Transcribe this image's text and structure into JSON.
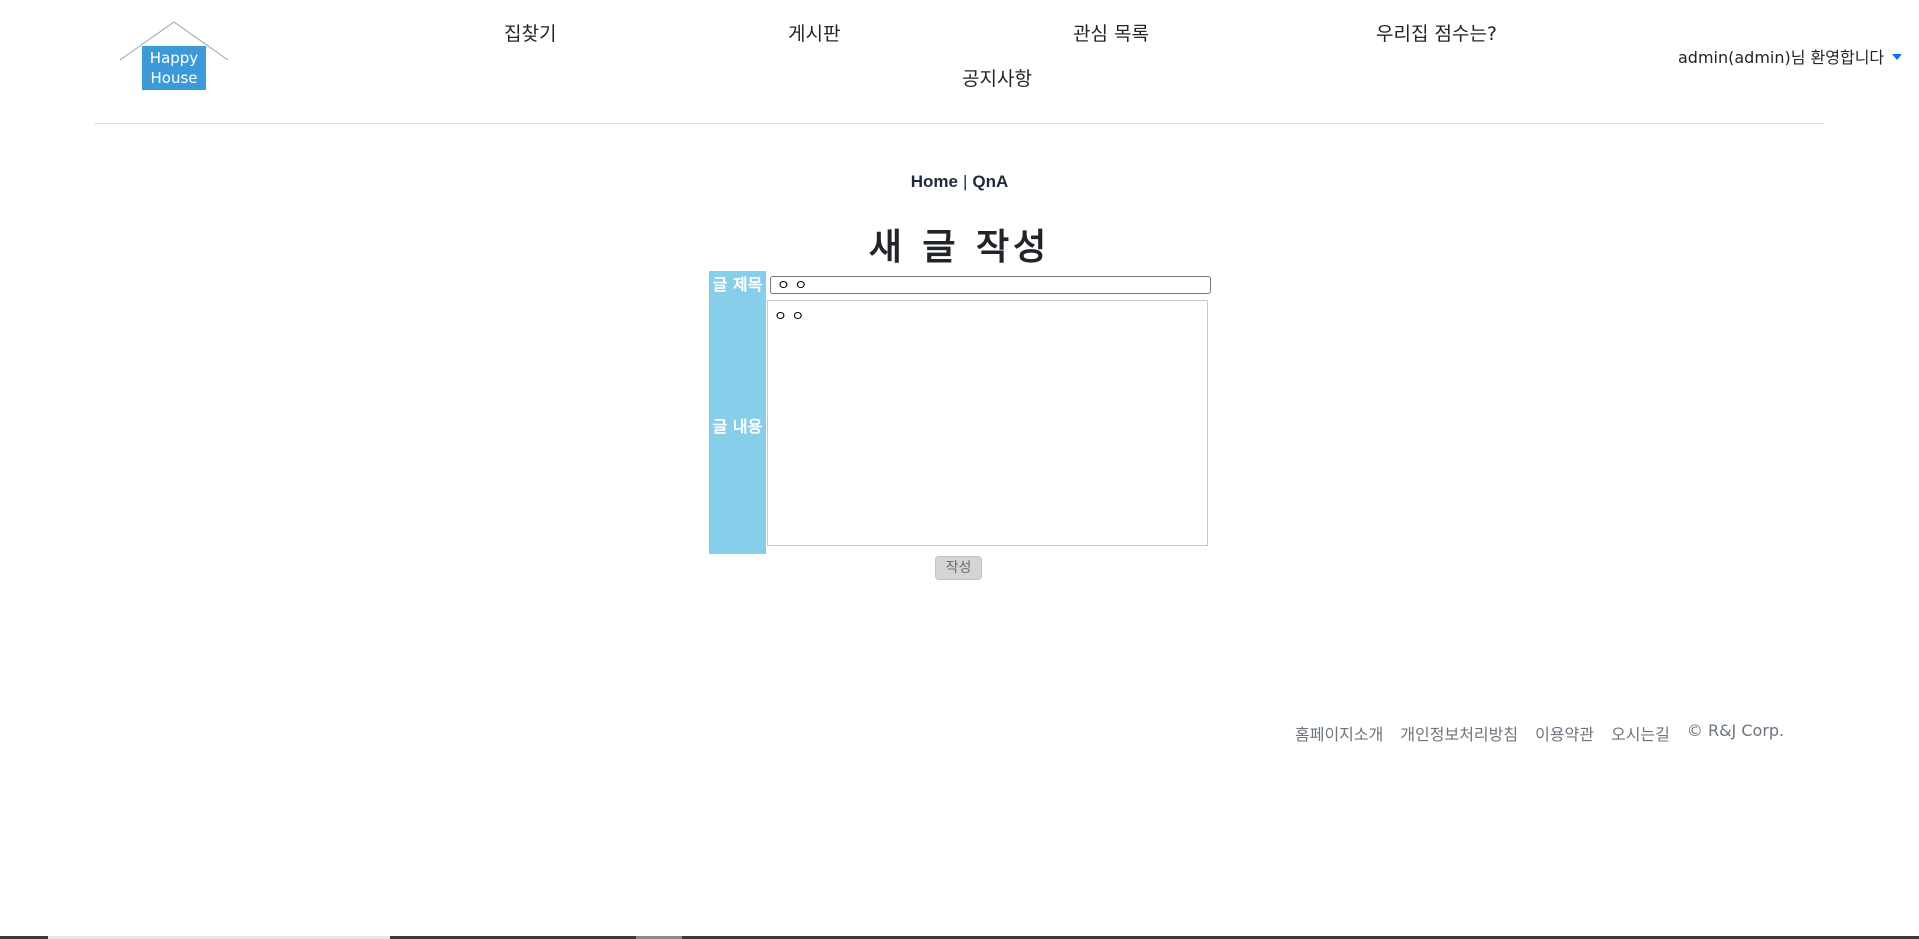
{
  "logo": {
    "line1": "Happy",
    "line2": "House",
    "color": "#3c9ad9"
  },
  "nav": {
    "items": [
      {
        "label": "집찾기"
      },
      {
        "label": "게시판"
      },
      {
        "label": "관심 목록"
      },
      {
        "label": "우리집 점수는?"
      },
      {
        "label": "공지사항"
      }
    ],
    "user_greeting": "admin(admin)님 환영합니다"
  },
  "breadcrumb": {
    "home": "Home",
    "separator": "|",
    "current": "QnA"
  },
  "page_title": "새 글 작성",
  "form": {
    "title_label": "글 제목",
    "title_value": "ㅇ ㅇ",
    "content_label": "글 내용",
    "content_value": "ㅇ ㅇ",
    "submit_label": "작성",
    "label_bg": "#87ceeb"
  },
  "footer": {
    "links": [
      "홈페이지소개",
      "개인정보처리방침",
      "이용약관",
      "오시는길"
    ],
    "copyright": "© R&J Corp."
  }
}
